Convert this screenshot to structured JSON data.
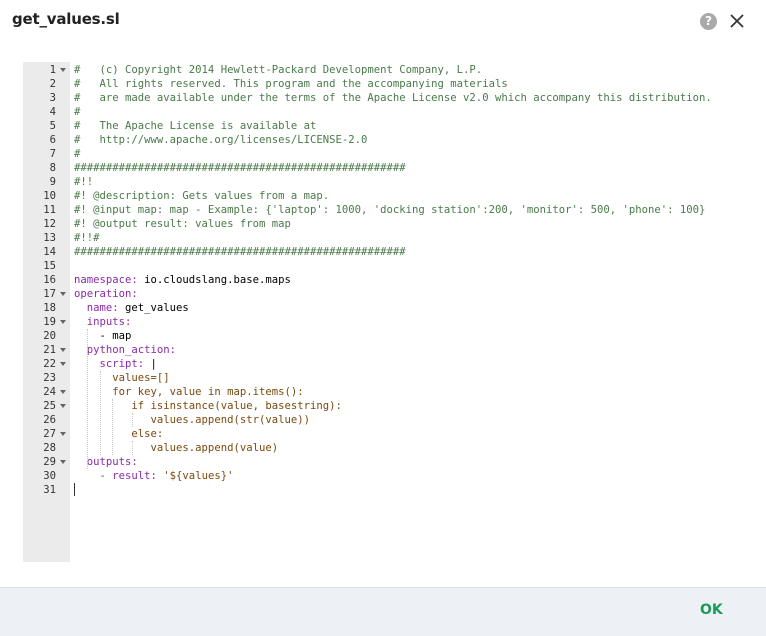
{
  "dialog": {
    "title": "get_values.sl",
    "help_glyph": "?",
    "ok_label": "OK"
  },
  "icons": {
    "help": "help-icon",
    "close": "close-icon",
    "fold": "fold-arrow-icon"
  },
  "colors": {
    "accent": "#1a9a5a",
    "footer_bg": "#edf1f5",
    "gutter_bg": "#ebebeb",
    "comment": "#4a7a4a",
    "key": "#8a2aa8",
    "string": "#7a4a10"
  },
  "editor": {
    "lines": [
      {
        "n": "1",
        "fold": true,
        "text": "#   (c) Copyright 2014 Hewlett-Packard Development Company, L.P.",
        "type": "comment"
      },
      {
        "n": "2",
        "fold": false,
        "text": "#   All rights reserved. This program and the accompanying materials",
        "type": "comment"
      },
      {
        "n": "3",
        "fold": false,
        "text": "#   are made available under the terms of the Apache License v2.0 which accompany this distribution.",
        "type": "comment"
      },
      {
        "n": "4",
        "fold": false,
        "text": "#",
        "type": "comment"
      },
      {
        "n": "5",
        "fold": false,
        "text": "#   The Apache License is available at",
        "type": "comment"
      },
      {
        "n": "6",
        "fold": false,
        "text": "#   http://www.apache.org/licenses/LICENSE-2.0",
        "type": "comment"
      },
      {
        "n": "7",
        "fold": false,
        "text": "#",
        "type": "comment"
      },
      {
        "n": "8",
        "fold": false,
        "text": "####################################################",
        "type": "comment"
      },
      {
        "n": "9",
        "fold": false,
        "text": "#!!",
        "type": "comment"
      },
      {
        "n": "10",
        "fold": false,
        "text": "#! @description: Gets values from a map.",
        "type": "comment"
      },
      {
        "n": "11",
        "fold": false,
        "text": "#! @input map: map - Example: {'laptop': 1000, 'docking station':200, 'monitor': 500, 'phone': 100}",
        "type": "comment"
      },
      {
        "n": "12",
        "fold": false,
        "text": "#! @output result: values from map",
        "type": "comment"
      },
      {
        "n": "13",
        "fold": false,
        "text": "#!!#",
        "type": "comment"
      },
      {
        "n": "14",
        "fold": false,
        "text": "####################################################",
        "type": "comment"
      },
      {
        "n": "15",
        "fold": false,
        "text": "",
        "type": "plain"
      },
      {
        "n": "16",
        "fold": false,
        "key": "namespace:",
        "rest": " io.cloudslang.base.maps",
        "type": "kv"
      },
      {
        "n": "17",
        "fold": true,
        "key": "operation:",
        "rest": "",
        "type": "kv"
      },
      {
        "n": "18",
        "fold": false,
        "key": "  name:",
        "rest": " get_values",
        "type": "kv"
      },
      {
        "n": "19",
        "fold": true,
        "key": "  inputs:",
        "rest": "",
        "type": "kv"
      },
      {
        "n": "20",
        "fold": false,
        "text": "    - map",
        "type": "plain"
      },
      {
        "n": "21",
        "fold": true,
        "key": "  python_action:",
        "rest": "",
        "type": "kv"
      },
      {
        "n": "22",
        "fold": true,
        "key": "    script:",
        "rest": " |",
        "type": "kv"
      },
      {
        "n": "23",
        "fold": false,
        "text": "      values=[]",
        "type": "str"
      },
      {
        "n": "24",
        "fold": true,
        "text": "      for key, value in map.items():",
        "type": "str"
      },
      {
        "n": "25",
        "fold": true,
        "text": "         if isinstance(value, basestring):",
        "type": "str"
      },
      {
        "n": "26",
        "fold": false,
        "text": "            values.append(str(value))",
        "type": "str"
      },
      {
        "n": "27",
        "fold": true,
        "text": "         else:",
        "type": "str"
      },
      {
        "n": "28",
        "fold": false,
        "text": "            values.append(value)",
        "type": "str"
      },
      {
        "n": "29",
        "fold": true,
        "key": "  outputs:",
        "rest": "",
        "type": "kv"
      },
      {
        "n": "30",
        "fold": false,
        "key": "    - result:",
        "rest": " '${values}'",
        "type": "kvs"
      },
      {
        "n": "31",
        "fold": false,
        "text": "",
        "type": "plain"
      }
    ]
  }
}
